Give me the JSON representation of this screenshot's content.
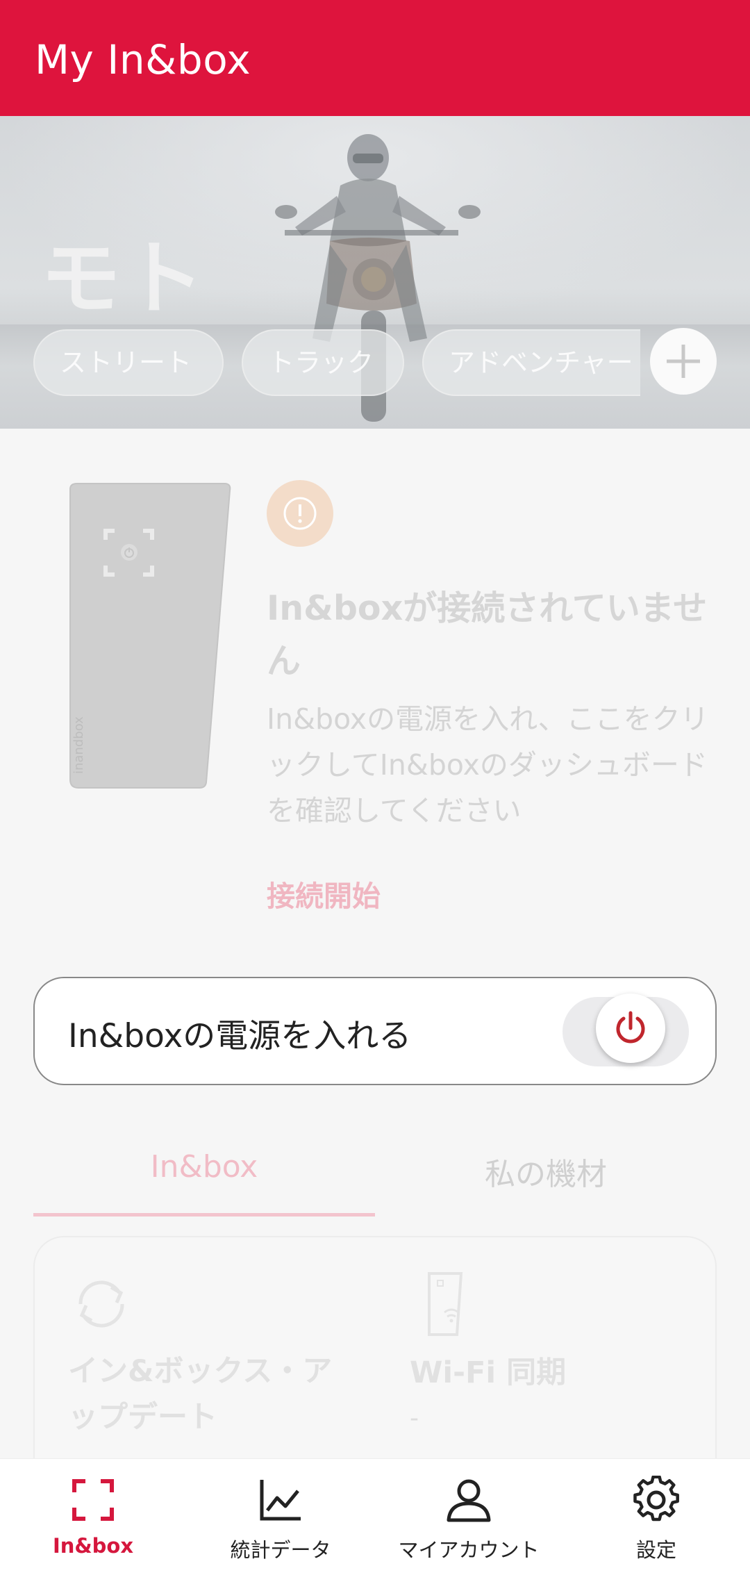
{
  "header": {
    "title": "My In&box"
  },
  "hero": {
    "title": "モト",
    "chips": [
      "ストリート",
      "トラック",
      "アドベンチャー"
    ]
  },
  "status": {
    "title": "In&boxが接続されていません",
    "description": "In&boxの電源を入れ、ここをクリックしてIn&boxのダッシュボードを確認してください",
    "connect_label": "接続開始"
  },
  "power": {
    "label": "In&boxの電源を入れる",
    "enabled": false
  },
  "tabs": [
    {
      "label": "In&box",
      "active": true
    },
    {
      "label": "私の機材",
      "active": false
    }
  ],
  "info": {
    "update_label": "イン&ボックス・アップデート",
    "wifi_label": "Wi-Fi 同期",
    "wifi_value": "-"
  },
  "nav": {
    "items": [
      {
        "label": "In&box",
        "icon": "inbox-frame-icon",
        "active": true
      },
      {
        "label": "統計データ",
        "icon": "chart-icon",
        "active": false
      },
      {
        "label": "マイアカウント",
        "icon": "user-icon",
        "active": false
      },
      {
        "label": "設定",
        "icon": "gear-icon",
        "active": false
      }
    ]
  },
  "colors": {
    "brand": "#de143d",
    "warning_bg": "#f3dcc9",
    "power_red": "#c0262d"
  }
}
